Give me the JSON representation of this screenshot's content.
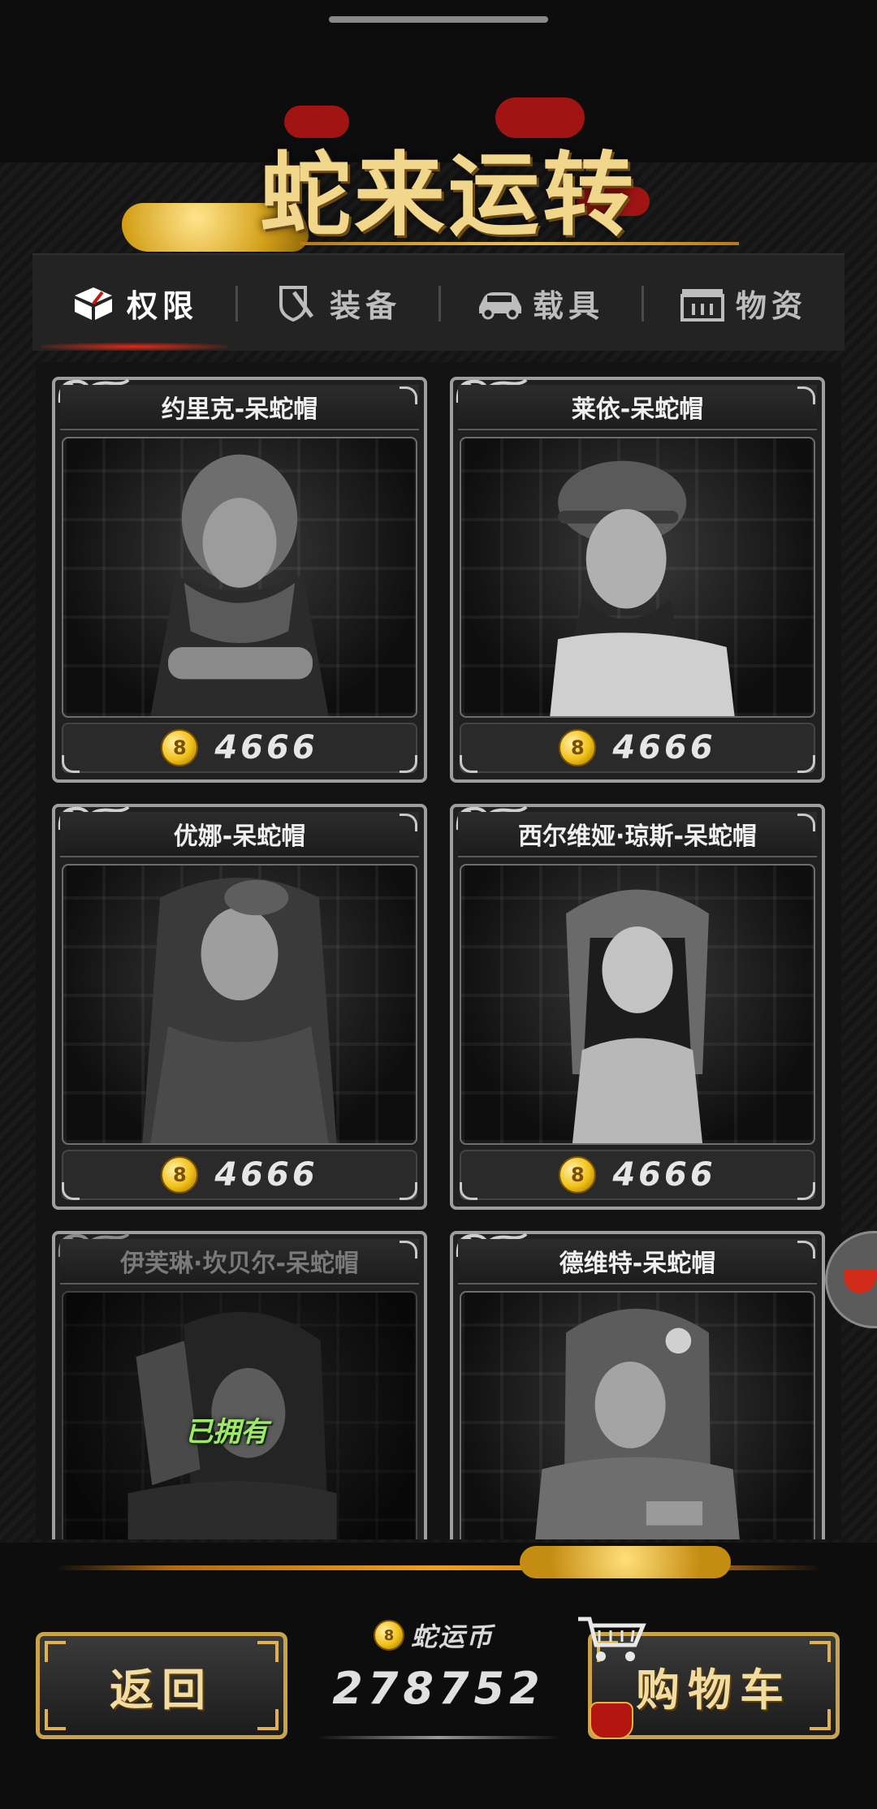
{
  "header": {
    "title": "蛇来运转"
  },
  "tabs": [
    {
      "label": "权限",
      "icon": "box-icon",
      "active": true
    },
    {
      "label": "装备",
      "icon": "shield-icon",
      "active": false
    },
    {
      "label": "载具",
      "icon": "car-icon",
      "active": false
    },
    {
      "label": "物资",
      "icon": "crate-icon",
      "active": false
    }
  ],
  "items": [
    {
      "name": "约里克-呆蛇帽",
      "price": "4666",
      "owned": false,
      "coin_glyph": "8"
    },
    {
      "name": "莱依-呆蛇帽",
      "price": "4666",
      "owned": false,
      "coin_glyph": "8"
    },
    {
      "name": "优娜-呆蛇帽",
      "price": "4666",
      "owned": false,
      "coin_glyph": "8"
    },
    {
      "name": "西尔维娅·琼斯-呆蛇帽",
      "price": "4666",
      "owned": false,
      "coin_glyph": "8"
    },
    {
      "name": "伊芙琳·坎贝尔-呆蛇帽",
      "owned": true,
      "owned_label": "已拥有"
    },
    {
      "name": "德维特-呆蛇帽",
      "owned": false
    }
  ],
  "footer": {
    "back_label": "返回",
    "cart_label": "购物车",
    "currency_name": "蛇运币",
    "currency_value": "278752",
    "coin_glyph": "8"
  },
  "colors": {
    "accent_gold": "#f1d78c",
    "owned_green": "#9fe86a",
    "active_tab_glow": "#e42a16"
  }
}
